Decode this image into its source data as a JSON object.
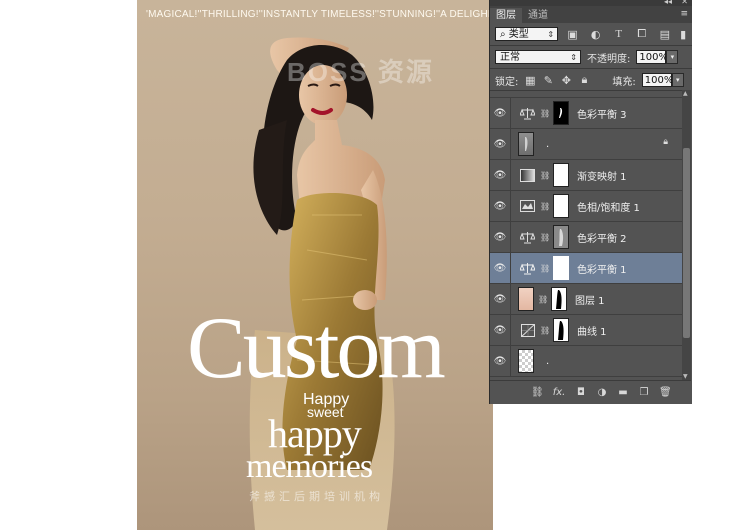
{
  "poster": {
    "quotes": [
      "'MAGICAL!'",
      "'THRILLING!'",
      "'INSTANTLY TIMELESS!'",
      "'STUNNING!'",
      "'A DELIGHE!'"
    ],
    "watermark": "BOSS 资源",
    "title_custom": "Custom",
    "subtitle_happy": "Happy",
    "subtitle_sweet": "sweet",
    "title_happy": "happy",
    "title_memories": "memories",
    "footer_cn": "斧撼汇后期培训机构"
  },
  "panel": {
    "tabs": [
      {
        "label": "图层",
        "active": true
      },
      {
        "label": "通道",
        "active": false
      }
    ],
    "filter_kind": "类型",
    "filter_icons": [
      "image-filter-icon",
      "adjustment-filter-icon",
      "type-filter-icon",
      "shape-filter-icon",
      "smart-object-filter-icon"
    ],
    "blend_mode": "正常",
    "opacity_label": "不透明度:",
    "opacity_value": "100%",
    "lock_label": "锁定:",
    "fill_label": "填充:",
    "fill_value": "100%",
    "layers": [
      {
        "name": "色彩平衡 3",
        "type": "adjustment",
        "icon": "color-balance-icon",
        "mask": "figure",
        "selected": false,
        "locked": false
      },
      {
        "name": ".",
        "type": "pixel",
        "icon": "photo-thumb",
        "mask": "",
        "selected": false,
        "locked": true
      },
      {
        "name": "渐变映射 1",
        "type": "adjustment",
        "icon": "gradient-map-icon",
        "mask": "white",
        "selected": false,
        "locked": false
      },
      {
        "name": "色相/饱和度 1",
        "type": "adjustment",
        "icon": "hue-saturation-icon",
        "mask": "white",
        "selected": false,
        "locked": false
      },
      {
        "name": "色彩平衡 2",
        "type": "adjustment",
        "icon": "color-balance-icon",
        "mask": "figure-gray",
        "selected": false,
        "locked": false
      },
      {
        "name": "色彩平衡 1",
        "type": "adjustment",
        "icon": "color-balance-icon",
        "mask": "white",
        "selected": true,
        "locked": false
      },
      {
        "name": "图层 1",
        "type": "pixel",
        "icon": "skin-thumb",
        "mask": "figure",
        "selected": false,
        "locked": false
      },
      {
        "name": "曲线 1",
        "type": "adjustment",
        "icon": "curves-icon",
        "mask": "figure",
        "selected": false,
        "locked": false
      },
      {
        "name": ".",
        "type": "pixel",
        "icon": "transparent-thumb",
        "mask": "",
        "selected": false,
        "locked": false
      }
    ],
    "bottom_icons": [
      "link-layers-icon",
      "fx-icon",
      "add-mask-icon",
      "new-adjustment-icon",
      "new-group-icon",
      "new-layer-icon",
      "delete-layer-icon"
    ],
    "fx_label": "fx."
  }
}
